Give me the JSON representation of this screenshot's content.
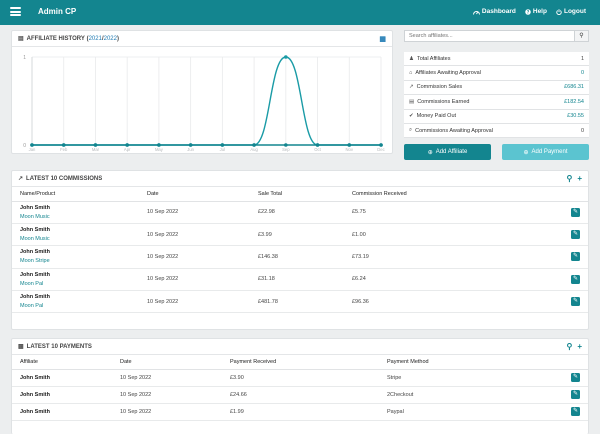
{
  "topbar": {
    "title": "Admin CP",
    "nav": {
      "dashboard": "Dashboard",
      "help": "Help",
      "logout": "Logout"
    }
  },
  "history": {
    "title": "AFFILIATE HISTORY",
    "open": "(",
    "year_a": "2021",
    "sep": " / ",
    "year_b": "2022",
    "close": ")"
  },
  "chart_data": {
    "type": "line",
    "categories": [
      "Jan",
      "Feb",
      "Mar",
      "Apr",
      "May",
      "Jun",
      "Jul",
      "Aug",
      "Sep",
      "Oct",
      "Nov",
      "Dec"
    ],
    "series": [
      {
        "values": [
          0,
          0,
          0,
          0,
          0,
          0,
          0,
          0,
          1,
          0,
          0,
          0
        ],
        "color": "#1a9ba6"
      },
      {
        "values": [
          0,
          0,
          0,
          0,
          0,
          0,
          0,
          0,
          0,
          0,
          0,
          0
        ],
        "color": "#13858f"
      }
    ],
    "yticks": [
      "0",
      "1"
    ],
    "ylim": [
      0,
      1
    ]
  },
  "search": {
    "placeholder": "Search affiliates..."
  },
  "stats": [
    {
      "icon": "users-icon",
      "label": "Total Affiliates",
      "value": "1",
      "dark": true
    },
    {
      "icon": "lock-icon",
      "label": "Affiliates Awaiting Approval",
      "value": "0",
      "dark": false
    },
    {
      "icon": "chart-icon",
      "label": "Commission Sales",
      "value": "£686.31",
      "dark": false
    },
    {
      "icon": "money-icon",
      "label": "Commissions Earned",
      "value": "£182.54",
      "dark": false
    },
    {
      "icon": "check-icon",
      "label": "Money Paid Out",
      "value": "£30.55",
      "dark": false
    },
    {
      "icon": "search-icon",
      "label": "Commissions Awaiting Approval",
      "value": "0",
      "dark": true
    }
  ],
  "buttons": {
    "add_affiliate": "Add Affiliate",
    "add_payment": "Add Payment",
    "colors": {
      "add_affiliate": "#13858f",
      "add_payment": "#5bc4d0"
    }
  },
  "commissions": {
    "title": "LATEST 10 COMMISSIONS",
    "headers": [
      "Name/Product",
      "Date",
      "Sale Total",
      "Commission Received"
    ],
    "rows": [
      {
        "name": "John Smith",
        "product": "Moon Music",
        "date": "10 Sep 2022",
        "total": "£22.98",
        "commission": "£5.75"
      },
      {
        "name": "John Smith",
        "product": "Moon Music",
        "date": "10 Sep 2022",
        "total": "£3.99",
        "commission": "£1.00"
      },
      {
        "name": "John Smith",
        "product": "Moon Stripe",
        "date": "10 Sep 2022",
        "total": "£146.38",
        "commission": "£73.19"
      },
      {
        "name": "John Smith",
        "product": "Moon Pal",
        "date": "10 Sep 2022",
        "total": "£31.18",
        "commission": "£6.24"
      },
      {
        "name": "John Smith",
        "product": "Moon Pal",
        "date": "10 Sep 2022",
        "total": "£481.78",
        "commission": "£96.36"
      }
    ]
  },
  "payments": {
    "title": "LATEST 10 PAYMENTS",
    "headers": [
      "Affiliate",
      "Date",
      "Payment Received",
      "Payment Method"
    ],
    "rows": [
      {
        "name": "John Smith",
        "date": "10 Sep 2022",
        "amount": "£3.90",
        "method": "Stripe"
      },
      {
        "name": "John Smith",
        "date": "10 Sep 2022",
        "amount": "£24.66",
        "method": "2Checkout"
      },
      {
        "name": "John Smith",
        "date": "10 Sep 2022",
        "amount": "£1.99",
        "method": "Paypal"
      }
    ]
  }
}
